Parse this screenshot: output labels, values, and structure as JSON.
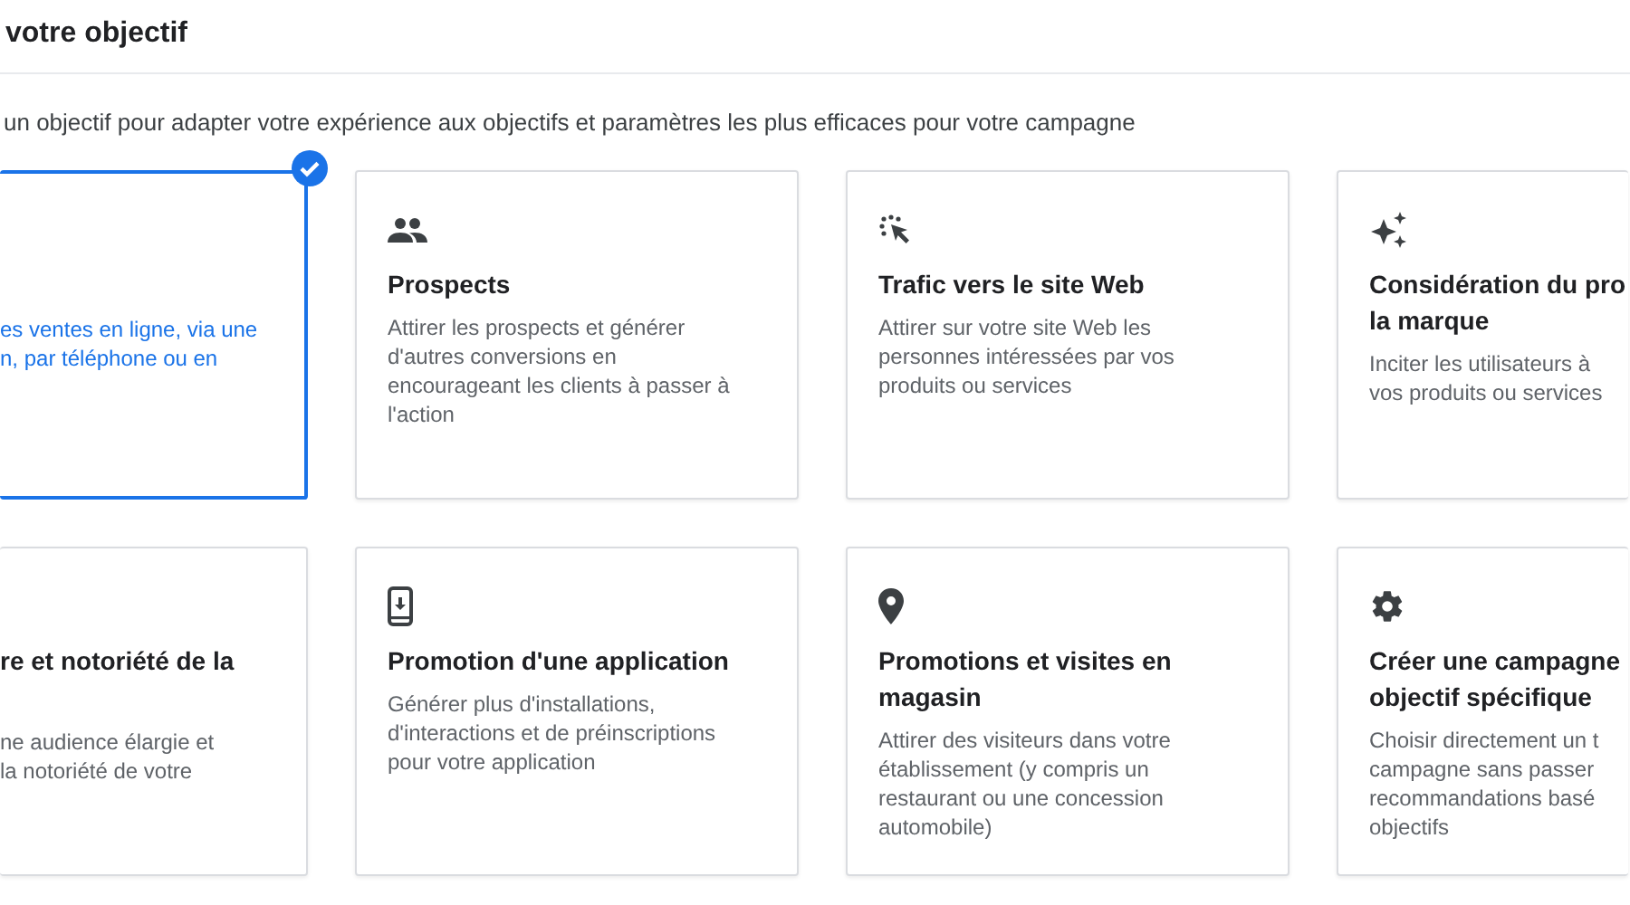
{
  "header": {
    "title": "votre objectif"
  },
  "subtitle": "un objectif pour adapter votre expérience aux objectifs et paramètres les plus efficaces pour votre campagne",
  "cards": [
    {
      "description_lines": [
        "es ventes en ligne, via une",
        "n, par téléphone ou en"
      ],
      "selected": true
    },
    {
      "title_lines": [
        "Prospects"
      ],
      "description_lines": [
        "Attirer les prospects et générer",
        "d'autres conversions en",
        "encourageant les clients à passer à",
        "l'action"
      ],
      "selected": false
    },
    {
      "title_lines": [
        "Trafic vers le site Web"
      ],
      "description_lines": [
        "Attirer sur votre site Web les",
        "personnes intéressées par vos",
        "produits ou services"
      ],
      "selected": false
    },
    {
      "title_lines": [
        "Considération du pro",
        "la marque"
      ],
      "description_lines": [
        "Inciter les utilisateurs à",
        "vos produits ou services"
      ],
      "selected": false
    },
    {
      "title_lines": [
        "re et notoriété de la"
      ],
      "description_lines": [
        "ne audience élargie et",
        "la notoriété de votre"
      ],
      "selected": false
    },
    {
      "title_lines": [
        "Promotion d'une application"
      ],
      "description_lines": [
        "Générer plus d'installations,",
        "d'interactions et de préinscriptions",
        "pour votre application"
      ],
      "selected": false
    },
    {
      "title_lines": [
        "Promotions et visites en",
        "magasin"
      ],
      "description_lines": [
        "Attirer des visiteurs dans votre",
        "établissement (y compris un",
        "restaurant ou une concession",
        "automobile)"
      ],
      "selected": false
    },
    {
      "title_lines": [
        "Créer une campagne",
        "objectif spécifique"
      ],
      "description_lines": [
        "Choisir directement un t",
        "campagne sans passer",
        "recommandations basé",
        "objectifs"
      ],
      "selected": false
    }
  ]
}
